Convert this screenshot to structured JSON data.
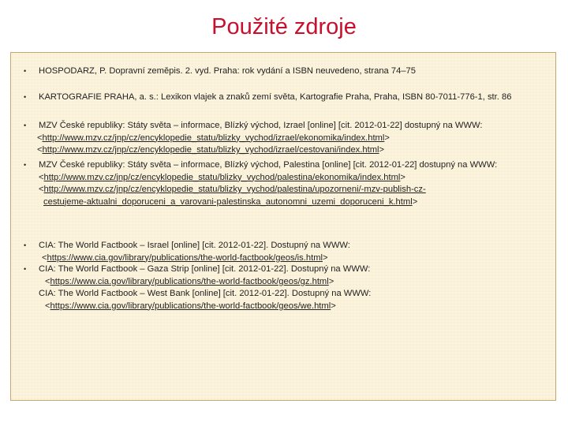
{
  "title": "Použité zdroje",
  "refs": {
    "r1": "HOSPODARZ, P. Dopravní zeměpis. 2. vyd. Praha: rok vydání a ISBN neuvedeno, strana  74–75",
    "r2": "KARTOGRAFIE PRAHA, a. s.: Lexikon vlajek a znaků zemí světa, Kartografie Praha, Praha, ISBN 80-7011-776-1, str. 86",
    "r3_text": "MZV České republiky: Státy světa – informace, Blízký východ, Izrael [online] [cit. 2012-01-22] dostupný na WWW:",
    "r3_link1": "http://www.mzv.cz/jnp/cz/encyklopedie_statu/blizky_vychod/izrael/ekonomika/index.html",
    "r3_link2": "http://www.mzv.cz/jnp/cz/encyklopedie_statu/blizky_vychod/izrael/cestovani/index.html",
    "r4_text": "MZV České republiky: Státy světa – informace, Blízký východ, Palestina [online] [cit. 2012-01-22] dostupný na WWW:",
    "r4_link1": "http://www.mzv.cz/jnp/cz/encyklopedie_statu/blizky_vychod/palestina/ekonomika/index.html",
    "r4_link2a": "http://www.mzv.cz/jnp/cz/encyklopedie_statu/blizky_vychod/palestina/upozorneni/-mzv-publish-cz-",
    "r4_link2b": "cestujeme-aktualni_doporuceni_a_varovani-palestinska_autonomni_uzemi_doporuceni_k.html",
    "r5_text": "CIA: The World Factbook – Israel [online] [cit. 2012-01-22]. Dostupný na WWW:",
    "r5_link": "https://www.cia.gov/library/publications/the-world-factbook/geos/is.html",
    "r6_text": "CIA: The World Factbook – Gaza Strip [online] [cit. 2012-01-22]. Dostupný na WWW:",
    "r6_link": "https://www.cia.gov/library/publications/the-world-factbook/geos/gz.html",
    "r7_text": "CIA: The World Factbook – West Bank [online] [cit. 2012-01-22]. Dostupný na WWW:",
    "r7_link": "https://www.cia.gov/library/publications/the-world-factbook/geos/we.html"
  },
  "bullet_glyph": "•",
  "link_open": "<",
  "link_close": ">"
}
